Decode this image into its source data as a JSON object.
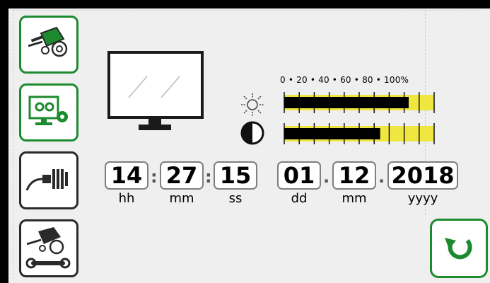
{
  "scale": {
    "label": "0 • 20 • 40 • 60 • 80 • 100%"
  },
  "brightness": {
    "icon": "sun-icon",
    "level_percent": 83
  },
  "contrast": {
    "icon": "contrast-icon",
    "level_percent": 64
  },
  "time": {
    "hours": "14",
    "hours_unit": "hh",
    "minutes": "27",
    "minutes_unit": "mm",
    "seconds": "15",
    "seconds_unit": "ss",
    "separator": ":"
  },
  "date": {
    "day": "01",
    "day_unit": "dd",
    "month": "12",
    "month_unit": "mm",
    "year": "2018",
    "year_unit": "yyyy",
    "separator": "."
  },
  "sidebar": {
    "items": [
      {
        "icon": "baler-icon",
        "style": "green"
      },
      {
        "icon": "display-settings-icon",
        "style": "green"
      },
      {
        "icon": "cable-plug-icon",
        "style": "dark"
      },
      {
        "icon": "baler-service-icon",
        "style": "dark"
      }
    ]
  },
  "colors": {
    "accent": "#1c8a2e",
    "bar_fill": "#000000",
    "bar_track": "#f0e640"
  },
  "reset": {
    "icon": "reset-icon"
  }
}
